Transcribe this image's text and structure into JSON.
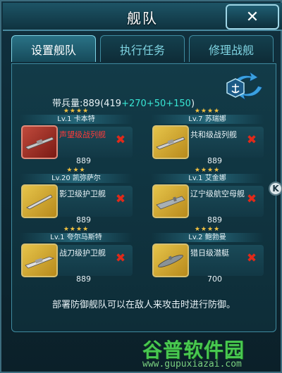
{
  "window": {
    "title": "舰队",
    "close_label": "✕"
  },
  "tabs": [
    {
      "label": "设置舰队",
      "active": true
    },
    {
      "label": "执行任务",
      "active": false
    },
    {
      "label": "修理战舰",
      "active": false
    }
  ],
  "troops": {
    "prefix": "带兵量:889(419",
    "bonus1": "+270",
    "bonus2": "+50",
    "bonus3": "+150",
    "suffix": ")"
  },
  "ships": [
    {
      "stars": "★★★★",
      "level_name": "Lv.1 卡本特",
      "ship_name": "声望级战列舰",
      "power": "889",
      "frame_color": "red"
    },
    {
      "stars": "★★★★",
      "level_name": "Lv.7 苏瑞娜",
      "ship_name": "共和级战列舰",
      "power": "889",
      "frame_color": "gold"
    },
    {
      "stars": "★★★",
      "level_name": "Lv.20 凯弥萨尔",
      "ship_name": "影卫级护卫舰",
      "power": "889",
      "frame_color": "gold"
    },
    {
      "stars": "★★★★",
      "level_name": "Lv.1 艾金娜",
      "ship_name": "辽宁级航空母舰",
      "power": "889",
      "frame_color": "gold"
    },
    {
      "stars": "★★★★",
      "level_name": "Lv.1 夸尔马斯特",
      "ship_name": "战刀级护卫舰",
      "power": "889",
      "frame_color": "gold"
    },
    {
      "stars": "★★★★",
      "level_name": "Lv.2 鲍勃曼",
      "ship_name": "猎日级潜艇",
      "power": "700",
      "frame_color": "gold"
    }
  ],
  "hint": "部署防御舰队可以在敌人来攻击时进行防御。",
  "side_button": "K",
  "watermark": {
    "logo": "谷普软件园",
    "url": "www.gupuxiazai.com"
  },
  "colors": {
    "bonus": "#38e6d4",
    "remove": "#e02a1a",
    "stars": "#f0c040"
  }
}
